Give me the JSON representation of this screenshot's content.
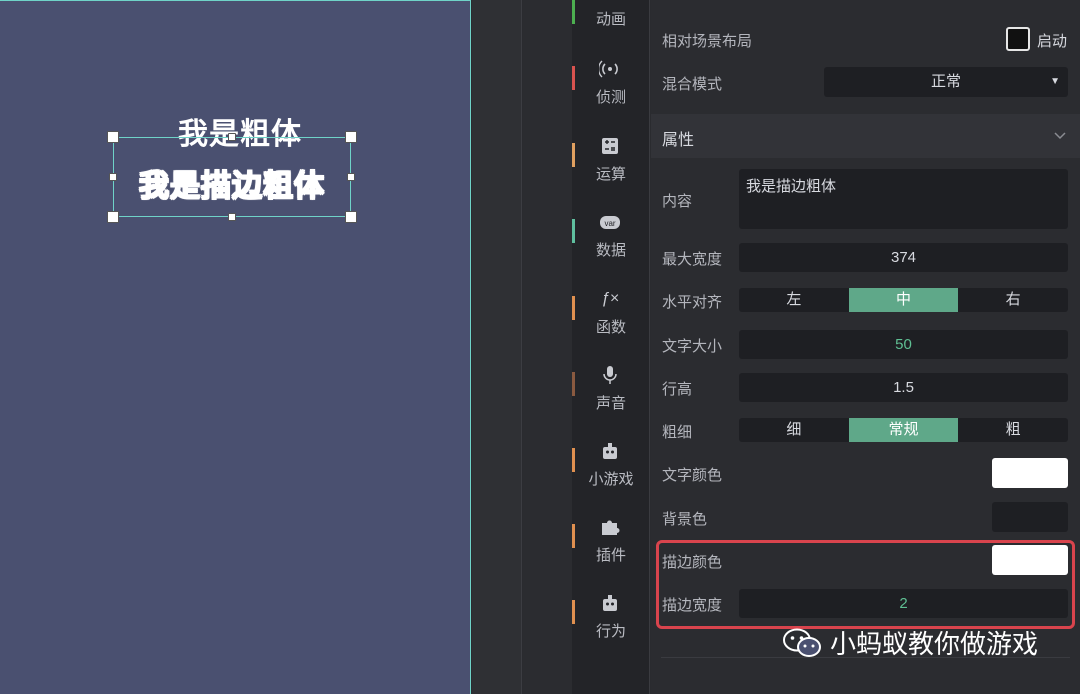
{
  "canvas": {
    "text_bold": "我是粗体",
    "text_stroke": "我是描边粗体"
  },
  "tools": [
    {
      "label": "动画",
      "icon": "animation-icon",
      "color": "#4caf50"
    },
    {
      "label": "侦测",
      "icon": "sensor-icon",
      "color": "#d9534f"
    },
    {
      "label": "运算",
      "icon": "calculator-icon",
      "color": "#e0a060"
    },
    {
      "label": "数据",
      "icon": "variable-icon",
      "color": "#5fbf9f"
    },
    {
      "label": "函数",
      "icon": "function-icon",
      "color": "#e09050"
    },
    {
      "label": "声音",
      "icon": "microphone-icon",
      "color": "#8a5a40"
    },
    {
      "label": "小游戏",
      "icon": "robot-icon",
      "color": "#e09050"
    },
    {
      "label": "插件",
      "icon": "puzzle-icon",
      "color": "#e09050"
    },
    {
      "label": "行为",
      "icon": "robot-icon",
      "color": "#e09050"
    }
  ],
  "panel": {
    "relative_layout_label": "相对场景布局",
    "relative_layout_toggle": "启动",
    "blend_mode_label": "混合模式",
    "blend_mode_value": "正常",
    "section_title": "属性",
    "content_label": "内容",
    "content_value": "我是描边粗体",
    "max_width_label": "最大宽度",
    "max_width_value": "374",
    "h_align_label": "水平对齐",
    "h_align_options": [
      "左",
      "中",
      "右"
    ],
    "h_align_selected": "中",
    "font_size_label": "文字大小",
    "font_size_value": "50",
    "line_height_label": "行高",
    "line_height_value": "1.5",
    "weight_label": "粗细",
    "weight_options": [
      "细",
      "常规",
      "粗"
    ],
    "weight_selected": "常规",
    "text_color_label": "文字颜色",
    "text_color": "#ffffff",
    "bg_color_label": "背景色",
    "bg_color": "#1e1f23",
    "stroke_color_label": "描边颜色",
    "stroke_color": "#ffffff",
    "stroke_width_label": "描边宽度",
    "stroke_width_value": "2"
  },
  "watermark": "小蚂蚁教你做游戏"
}
